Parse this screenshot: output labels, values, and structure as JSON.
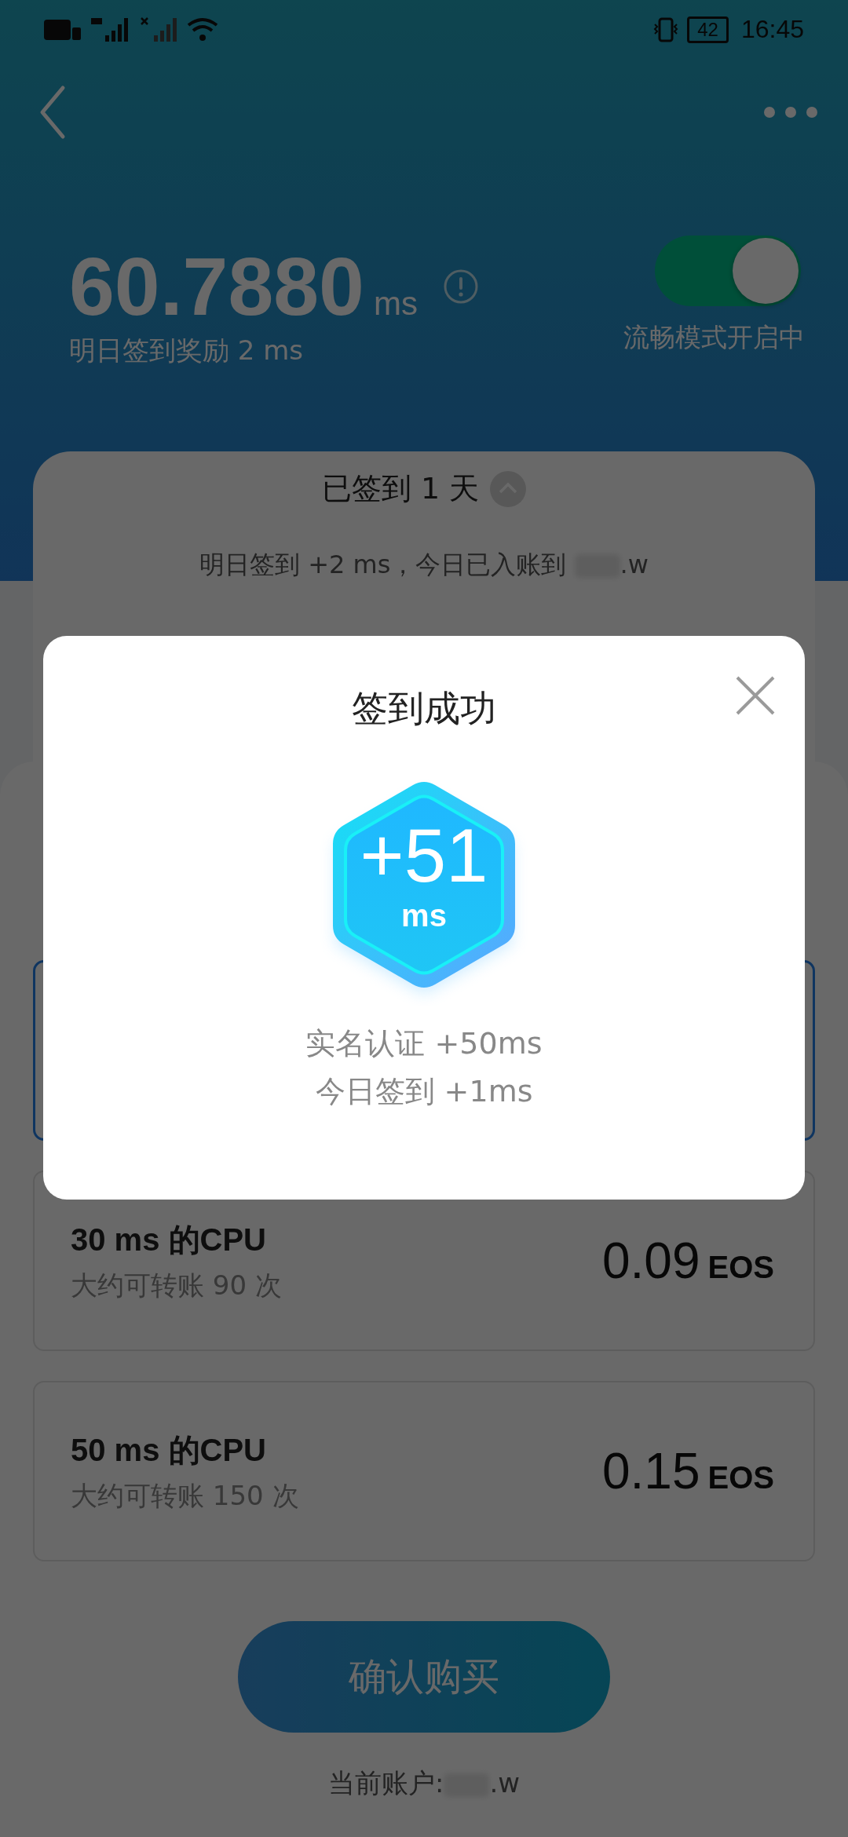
{
  "status_bar": {
    "battery": "42",
    "time": "16:45"
  },
  "header": {
    "balance": "60.7880",
    "unit": "ms",
    "reward_note": "明日签到奖励 2 ms",
    "smooth_mode": {
      "on": true,
      "label": "流畅模式开启中"
    }
  },
  "checkin_card": {
    "title": "已签到 1 天",
    "expanded": true,
    "notice_prefix": "明日签到 +2 ms，今日已入账到",
    "notice_suffix": ".w"
  },
  "plans": [
    {
      "selected": true
    },
    {
      "title": "30 ms 的CPU",
      "subtitle": "大约可转账 90 次",
      "price": "0.09",
      "currency": "EOS",
      "selected": false
    },
    {
      "title": "50 ms 的CPU",
      "subtitle": "大约可转账 150 次",
      "price": "0.15",
      "currency": "EOS",
      "selected": false
    }
  ],
  "confirm_button": "确认购买",
  "account": {
    "label": "当前账户:",
    "suffix": ".w"
  },
  "dialog": {
    "title": "签到成功",
    "amount": "+51",
    "unit": "ms",
    "details": [
      "实名认证 +50ms",
      "今日签到 +1ms"
    ]
  }
}
